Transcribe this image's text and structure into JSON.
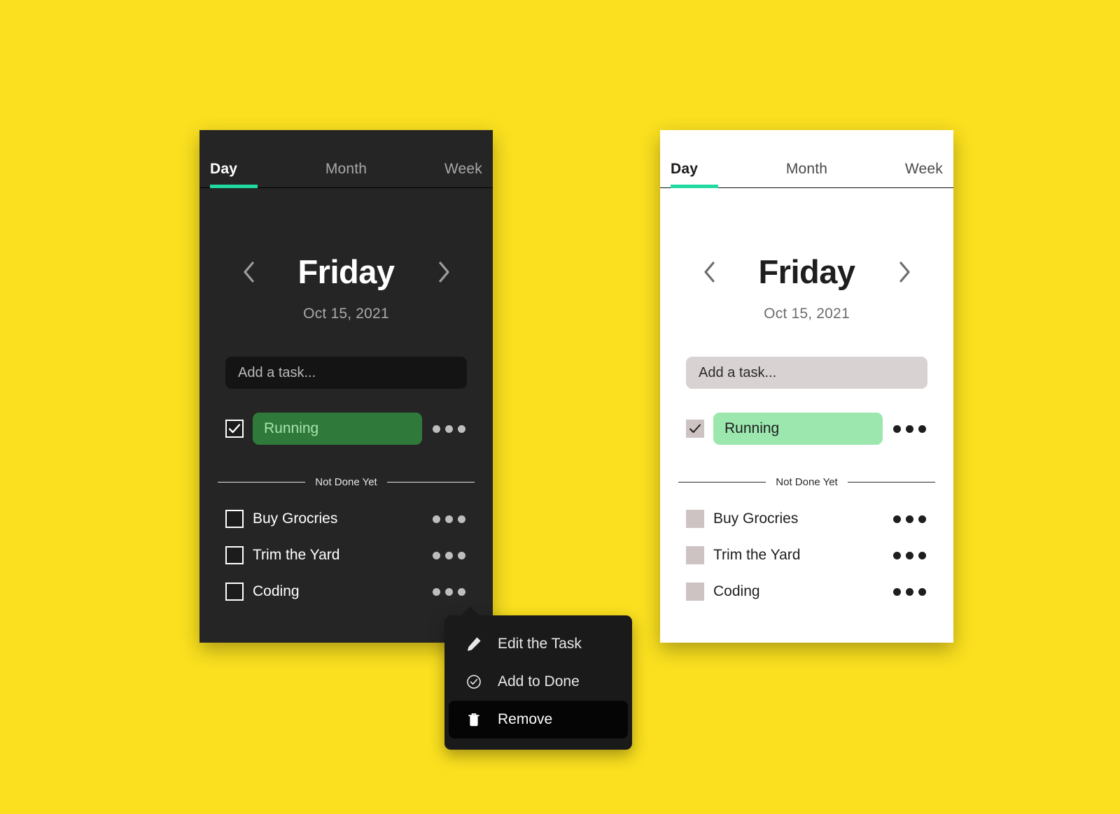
{
  "page": {
    "background_color": "#FAE01F",
    "accent_color": "#21D9A1"
  },
  "cards": {
    "dark": {
      "theme_label": "dark",
      "background_color": "#252525",
      "tabs": [
        {
          "label": "Day",
          "active": true
        },
        {
          "label": "Month",
          "active": false
        },
        {
          "label": "Week",
          "active": false
        }
      ],
      "day_nav": {
        "prev_icon": "chevron-left-icon",
        "day_name": "Friday",
        "next_icon": "chevron-right-icon",
        "date": "Oct 15, 2021"
      },
      "add_task": {
        "value": "",
        "placeholder": "Add a task..."
      },
      "done_tasks": [
        {
          "label": "Running",
          "checked": true,
          "pill_color": "#2F7A3A",
          "text_color": "#A9E2AE"
        }
      ],
      "divider_label": "Not Done Yet",
      "pending_tasks": [
        {
          "label": "Buy Grocries",
          "checked": false
        },
        {
          "label": "Trim the Yard",
          "checked": false
        },
        {
          "label": "Coding",
          "checked": false
        }
      ]
    },
    "light": {
      "theme_label": "light",
      "background_color": "#FFFFFF",
      "tabs": [
        {
          "label": "Day",
          "active": true
        },
        {
          "label": "Month",
          "active": false
        },
        {
          "label": "Week",
          "active": false
        }
      ],
      "day_nav": {
        "prev_icon": "chevron-left-icon",
        "day_name": "Friday",
        "next_icon": "chevron-right-icon",
        "date": "Oct 15, 2021"
      },
      "add_task": {
        "value": "",
        "placeholder": "Add a task..."
      },
      "done_tasks": [
        {
          "label": "Running",
          "checked": true,
          "pill_color": "#9BE7AE",
          "text_color": "#1E1E1E"
        }
      ],
      "divider_label": "Not Done Yet",
      "pending_tasks": [
        {
          "label": "Buy Grocries",
          "checked": false
        },
        {
          "label": "Trim the Yard",
          "checked": false
        },
        {
          "label": "Coding",
          "checked": false
        }
      ]
    }
  },
  "context_menu": {
    "items": [
      {
        "label": "Edit the Task",
        "icon": "pencil-icon",
        "highlighted": false
      },
      {
        "label": "Add to Done",
        "icon": "check-circle-icon",
        "highlighted": false
      },
      {
        "label": "Remove",
        "icon": "trash-icon",
        "highlighted": true
      }
    ]
  }
}
